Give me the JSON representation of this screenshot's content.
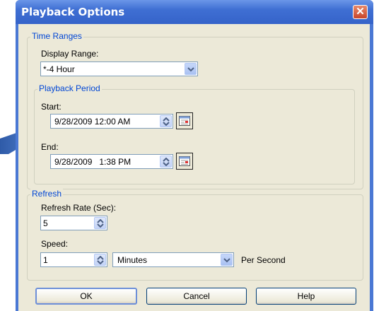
{
  "window": {
    "title": "Playback Options",
    "close_glyph": "✕"
  },
  "time_ranges": {
    "legend": "Time Ranges",
    "display_range_label": "Display Range:",
    "display_range_value": "*-4 Hour",
    "playback_period": {
      "legend": "Playback Period",
      "start_label": "Start:",
      "start_value": "9/28/2009 12:00 AM",
      "end_label": "End:",
      "end_value": "9/28/2009   1:38 PM"
    }
  },
  "refresh": {
    "legend": "Refresh",
    "refresh_rate_label": "Refresh Rate (Sec):",
    "refresh_rate_value": "5",
    "speed_label": "Speed:",
    "speed_value": "1",
    "speed_unit_value": "Minutes",
    "per_second_label": "Per Second"
  },
  "buttons": {
    "ok": "OK",
    "cancel": "Cancel",
    "help": "Help"
  },
  "colors": {
    "titlebar": "#3563c9",
    "legend_text": "#0046d5",
    "dialog_bg": "#ece9d8"
  }
}
